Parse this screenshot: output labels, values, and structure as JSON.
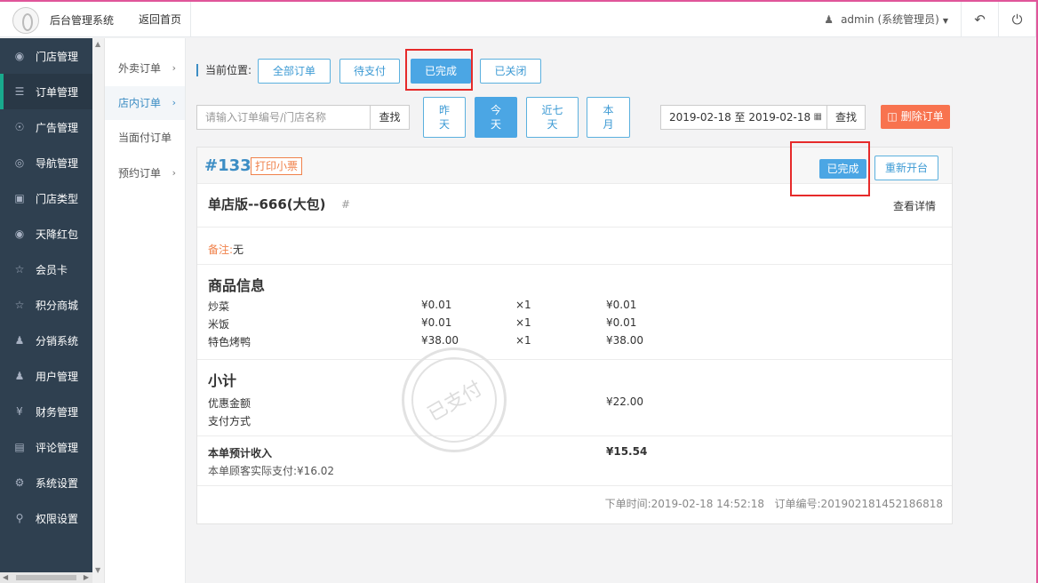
{
  "header": {
    "brand": "后台管理系统",
    "back_home": "返回首页",
    "user": "admin (系统管理员)",
    "icons": [
      "user-icon",
      "back-icon",
      "power-icon"
    ]
  },
  "sidebar": {
    "items": [
      {
        "icon": "cubes-icon",
        "label": "门店管理"
      },
      {
        "icon": "bars-icon",
        "label": "订单管理"
      },
      {
        "icon": "lifebuoy-icon",
        "label": "广告管理"
      },
      {
        "icon": "compass-icon",
        "label": "导航管理"
      },
      {
        "icon": "bank-icon",
        "label": "门店类型"
      },
      {
        "icon": "cubes-icon",
        "label": "天降红包"
      },
      {
        "icon": "star-icon",
        "label": "会员卡"
      },
      {
        "icon": "star-icon",
        "label": "积分商城"
      },
      {
        "icon": "users-icon",
        "label": "分销系统"
      },
      {
        "icon": "user-icon",
        "label": "用户管理"
      },
      {
        "icon": "yen-icon",
        "label": "财务管理"
      },
      {
        "icon": "money-icon",
        "label": "评论管理"
      },
      {
        "icon": "gear-icon",
        "label": "系统设置"
      },
      {
        "icon": "lock-icon",
        "label": "权限设置"
      }
    ],
    "active_label": "订单管理"
  },
  "subnav": {
    "items": [
      "外卖订单",
      "店内订单",
      "当面付订单",
      "预约订单"
    ],
    "active": "店内订单"
  },
  "filters": {
    "location_label": "当前位置:",
    "status_tabs": [
      "全部订单",
      "待支付",
      "已完成",
      "已关闭"
    ],
    "active_status": "已完成",
    "search_placeholder": "请输入订单编号/门店名称",
    "search_button": "查找",
    "date_tabs": [
      {
        "line1": "昨",
        "line2": "天"
      },
      {
        "line1": "今",
        "line2": "天"
      },
      {
        "line1": "近七",
        "line2": "天"
      },
      {
        "line1": "本",
        "line2": "月"
      }
    ],
    "active_date": "今天",
    "date_range": "2019-02-18 至 2019-02-18",
    "date_search_button": "查找",
    "delete_button": "删除订单"
  },
  "order": {
    "number": "#133",
    "print_label": "打印小票",
    "status": "已完成",
    "reopen_button": "重新开台",
    "store_name": "单店版--666(大包)",
    "hash": "#",
    "detail_link": "查看详情",
    "remark_label": "备注:",
    "remark_value": "无",
    "goods_title": "商品信息",
    "goods": [
      {
        "name": "炒菜",
        "price": "¥0.01",
        "qty": "×1",
        "total": "¥0.01"
      },
      {
        "name": "米饭",
        "price": "¥0.01",
        "qty": "×1",
        "total": "¥0.01"
      },
      {
        "name": "特色烤鸭",
        "price": "¥38.00",
        "qty": "×1",
        "total": "¥38.00"
      }
    ],
    "subtotal_title": "小计",
    "discount_label": "优惠金额",
    "discount_value": "¥22.00",
    "pay_method_label": "支付方式",
    "income_label": "本单预计收入",
    "income_value": "¥15.54",
    "actual_paid": "本单顾客实际支付:¥16.02",
    "order_time": "下单时间:2019-02-18 14:52:18",
    "order_code": "订单编号:201902181452186818",
    "stamp_text": "已支付"
  },
  "colors": {
    "sidebar_bg": "#2f4050",
    "accent": "#4ba6e4",
    "danger": "#f8734f",
    "highlight": "#e62a2a"
  }
}
